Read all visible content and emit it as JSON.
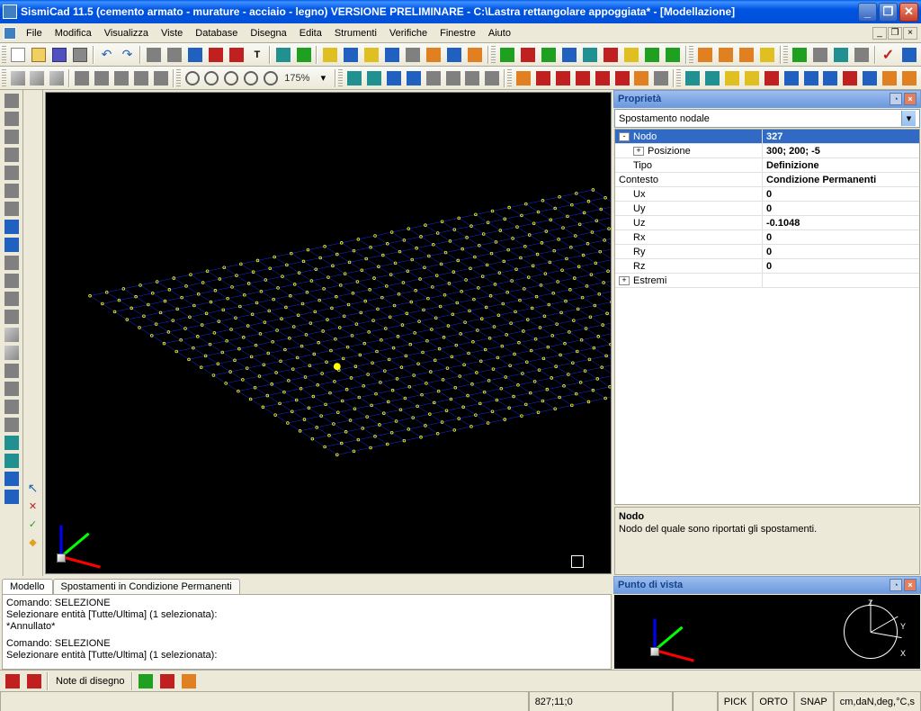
{
  "title": "SismiCad 11.5 (cemento armato - murature - acciaio - legno) VERSIONE PRELIMINARE - C:\\Lastra rettangolare appoggiata* - [Modellazione]",
  "menu": {
    "file": "File",
    "modifica": "Modifica",
    "visualizza": "Visualizza",
    "viste": "Viste",
    "database": "Database",
    "disegna": "Disegna",
    "edita": "Edita",
    "strumenti": "Strumenti",
    "verifiche": "Verifiche",
    "finestre": "Finestre",
    "aiuto": "Aiuto"
  },
  "zoom_pct": "175%",
  "properties": {
    "panel_title": "Proprietà",
    "dropdown": "Spostamento nodale",
    "rows": [
      {
        "name": "Nodo",
        "value": "327",
        "level": 0,
        "toggle": "-",
        "selected": true
      },
      {
        "name": "Posizione",
        "value": "300; 200; -5",
        "level": 1,
        "toggle": "+"
      },
      {
        "name": "Tipo",
        "value": "Definizione",
        "level": 1
      },
      {
        "name": "Contesto",
        "value": "Condizione Permanenti",
        "level": 0
      },
      {
        "name": "Ux",
        "value": "0",
        "level": 1
      },
      {
        "name": "Uy",
        "value": "0",
        "level": 1
      },
      {
        "name": "Uz",
        "value": "-0.1048",
        "level": 1
      },
      {
        "name": "Rx",
        "value": "0",
        "level": 1
      },
      {
        "name": "Ry",
        "value": "0",
        "level": 1
      },
      {
        "name": "Rz",
        "value": "0",
        "level": 1
      },
      {
        "name": "Estremi",
        "value": "",
        "level": 0,
        "toggle": "+"
      }
    ],
    "desc_title": "Nodo",
    "desc_text": "Nodo del quale sono riportati gli spostamenti."
  },
  "tabs": {
    "t1": "Modello",
    "t2": "Spostamenti in Condizione Permanenti"
  },
  "cmd": {
    "l1": "Comando: SELEZIONE",
    "l2": "Selezionare entità [Tutte/Ultima] (1 selezionata):",
    "l3": "*Annullato*",
    "l4": "Comando: SELEZIONE",
    "l5": "Selezionare entità [Tutte/Ultima] (1 selezionata):"
  },
  "pov": {
    "panel_title": "Punto di vista"
  },
  "bottom": {
    "note": "Note di disegno"
  },
  "status": {
    "coord": "827;11;0",
    "pick": "PICK",
    "orto": "ORTO",
    "snap": "SNAP",
    "units": "cm,daN,deg,°C,s"
  }
}
